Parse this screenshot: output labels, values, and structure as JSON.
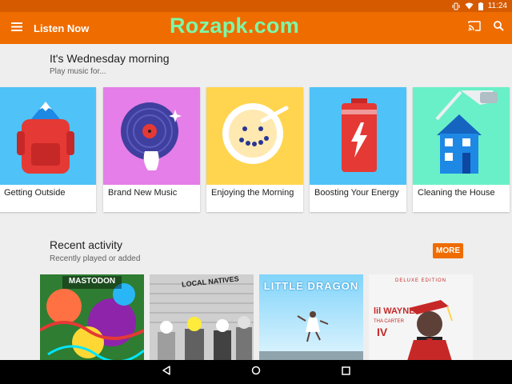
{
  "status_bar": {
    "time": "11:24"
  },
  "app_bar": {
    "title": "Listen Now",
    "watermark": "Rozapk.com"
  },
  "greeting": {
    "title": "It's Wednesday morning",
    "subtitle": "Play music for..."
  },
  "moods": [
    {
      "label": "Getting Outside",
      "bg": "#4fc3f7"
    },
    {
      "label": "Brand New Music",
      "bg": "#e57ee8"
    },
    {
      "label": "Enjoying the Morning",
      "bg": "#ffd54f"
    },
    {
      "label": "Boosting Your Energy",
      "bg": "#4fc3f7"
    },
    {
      "label": "Cleaning the House",
      "bg": "#69f0c8"
    }
  ],
  "recent": {
    "title": "Recent activity",
    "subtitle": "Recently played or added",
    "more_label": "MORE"
  },
  "albums": [
    {
      "title_text": "MASTODON",
      "bg": "#2e7d32"
    },
    {
      "title_text": "LOCAL NATIVES",
      "bg": "#bdbdbd"
    },
    {
      "title_text": "LITTLE DRAGON",
      "bg": "#b3e5fc"
    },
    {
      "title_text": "DELUXE EDITION",
      "artist_text": "lil WAYNE",
      "sub_text": "THA CARTER",
      "vol_text": "IV",
      "bg": "#f5f5f5"
    }
  ]
}
